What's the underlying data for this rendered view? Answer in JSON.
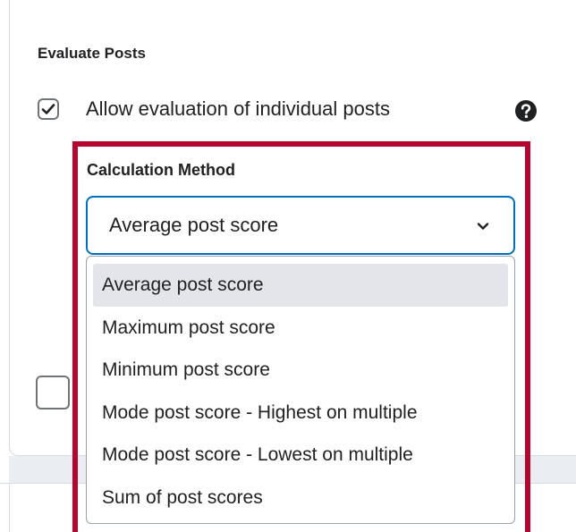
{
  "section": {
    "title": "Evaluate Posts"
  },
  "allow_evaluation": {
    "label": "Allow evaluation of individual posts",
    "checked": true,
    "help_icon": "question-circle-icon"
  },
  "calculation": {
    "label": "Calculation Method",
    "selected": "Average post score",
    "options": [
      {
        "label": "Average post score",
        "selected": true
      },
      {
        "label": "Maximum post score",
        "selected": false
      },
      {
        "label": "Minimum post score",
        "selected": false
      },
      {
        "label": "Mode post score - Highest on multiple",
        "selected": false
      },
      {
        "label": "Mode post score - Lowest on multiple",
        "selected": false
      },
      {
        "label": "Sum of post scores",
        "selected": false
      }
    ]
  },
  "colors": {
    "highlight_border": "#b4062f",
    "select_focus_border": "#006fbf",
    "selected_option_bg": "#e3e5ea"
  }
}
